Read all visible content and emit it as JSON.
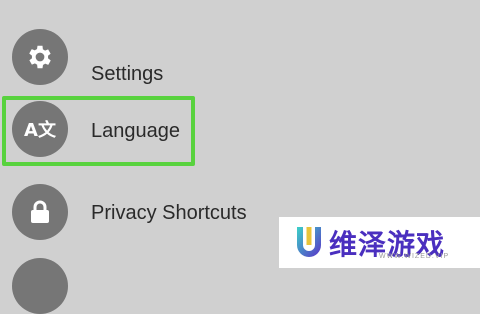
{
  "menu": {
    "items": [
      {
        "label": "Settings",
        "icon": "gear-icon"
      },
      {
        "label": "Language",
        "icon": "language-icon",
        "icon_text": "A文",
        "highlighted": true
      },
      {
        "label": "Privacy Shortcuts",
        "icon": "lock-icon"
      }
    ]
  },
  "colors": {
    "background": "#d0d0d0",
    "icon_circle": "#767676",
    "highlight": "#58d23e",
    "watermark_text": "#4a2fbf"
  },
  "watermark": {
    "title": "维泽游戏",
    "subtitle": "WWW.WIZED.VIP",
    "icon": "u-logo-icon"
  }
}
